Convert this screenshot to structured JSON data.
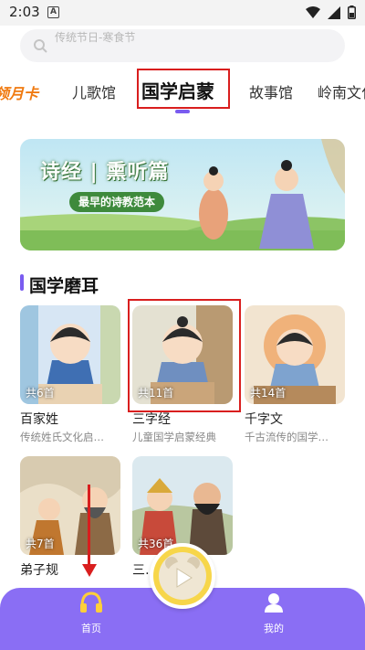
{
  "status_bar": {
    "time": "2:03",
    "notification_letter": "A"
  },
  "search": {
    "placeholder": "传统节日-寒食节"
  },
  "tabs": [
    {
      "label": "领月卡",
      "kind": "vip"
    },
    {
      "label": "儿歌馆"
    },
    {
      "label": "国学启蒙",
      "active": true
    },
    {
      "label": "故事馆"
    },
    {
      "label": "岭南文化"
    }
  ],
  "banner": {
    "title": "诗经 | 熏听篇",
    "subtitle": "最早的诗教范本"
  },
  "section": {
    "title": "国学磨耳"
  },
  "cards": [
    {
      "title": "百家姓",
      "desc": "传统姓氏文化启…",
      "count": "共6首"
    },
    {
      "title": "三字经",
      "desc": "儿童国学启蒙经典",
      "count": "共11首"
    },
    {
      "title": "千字文",
      "desc": "千古流传的国学…",
      "count": "共14首"
    },
    {
      "title": "弟子规",
      "desc": "",
      "count": "共7首"
    },
    {
      "title": "三…",
      "desc": "",
      "count": "共36首"
    }
  ],
  "bottom_nav": {
    "home_label": "首页",
    "mine_label": "我的"
  },
  "colors": {
    "accent": "#8a6ef4",
    "vip": "#f07a10",
    "annotation": "#d91e1e",
    "play": "#f7d64a"
  }
}
